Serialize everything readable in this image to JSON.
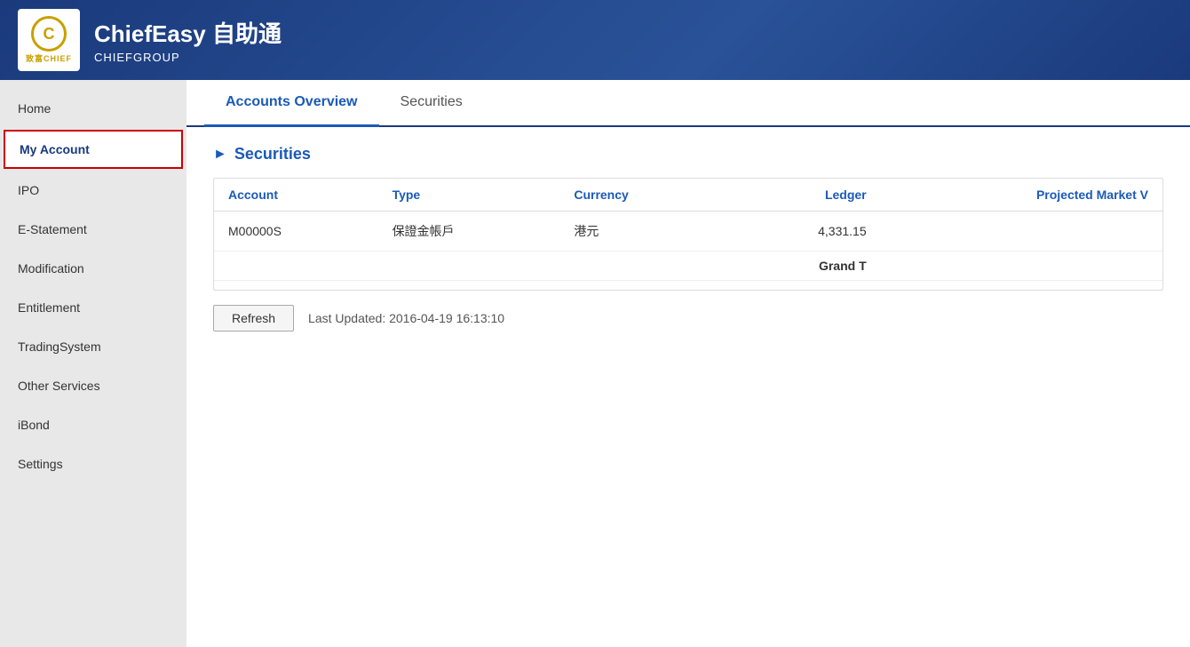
{
  "header": {
    "app_name": "ChiefEasy 自助通",
    "company": "CHIEFGROUP"
  },
  "sidebar": {
    "items": [
      {
        "label": "Home",
        "active": false
      },
      {
        "label": "My Account",
        "active": true
      },
      {
        "label": "IPO",
        "active": false
      },
      {
        "label": "E-Statement",
        "active": false
      },
      {
        "label": "Modification",
        "active": false
      },
      {
        "label": "Entitlement",
        "active": false
      },
      {
        "label": "TradingSystem",
        "active": false
      },
      {
        "label": "Other Services",
        "active": false
      },
      {
        "label": "iBond",
        "active": false
      },
      {
        "label": "Settings",
        "active": false
      }
    ]
  },
  "tabs": [
    {
      "label": "Accounts Overview",
      "active": true
    },
    {
      "label": "Securities",
      "active": false
    }
  ],
  "section": {
    "title": "Securities",
    "columns": [
      "Account",
      "Type",
      "Currency",
      "Ledger",
      "Projected Market V"
    ],
    "rows": [
      {
        "account": "M00000S",
        "type": "保證金帳戶",
        "currency": "港元",
        "ledger": "4,331.15",
        "projected": ""
      }
    ],
    "grand_total_label": "Grand T"
  },
  "refresh": {
    "button_label": "Refresh",
    "last_updated_label": "Last Updated: 2016-04-19 16:13:10"
  }
}
